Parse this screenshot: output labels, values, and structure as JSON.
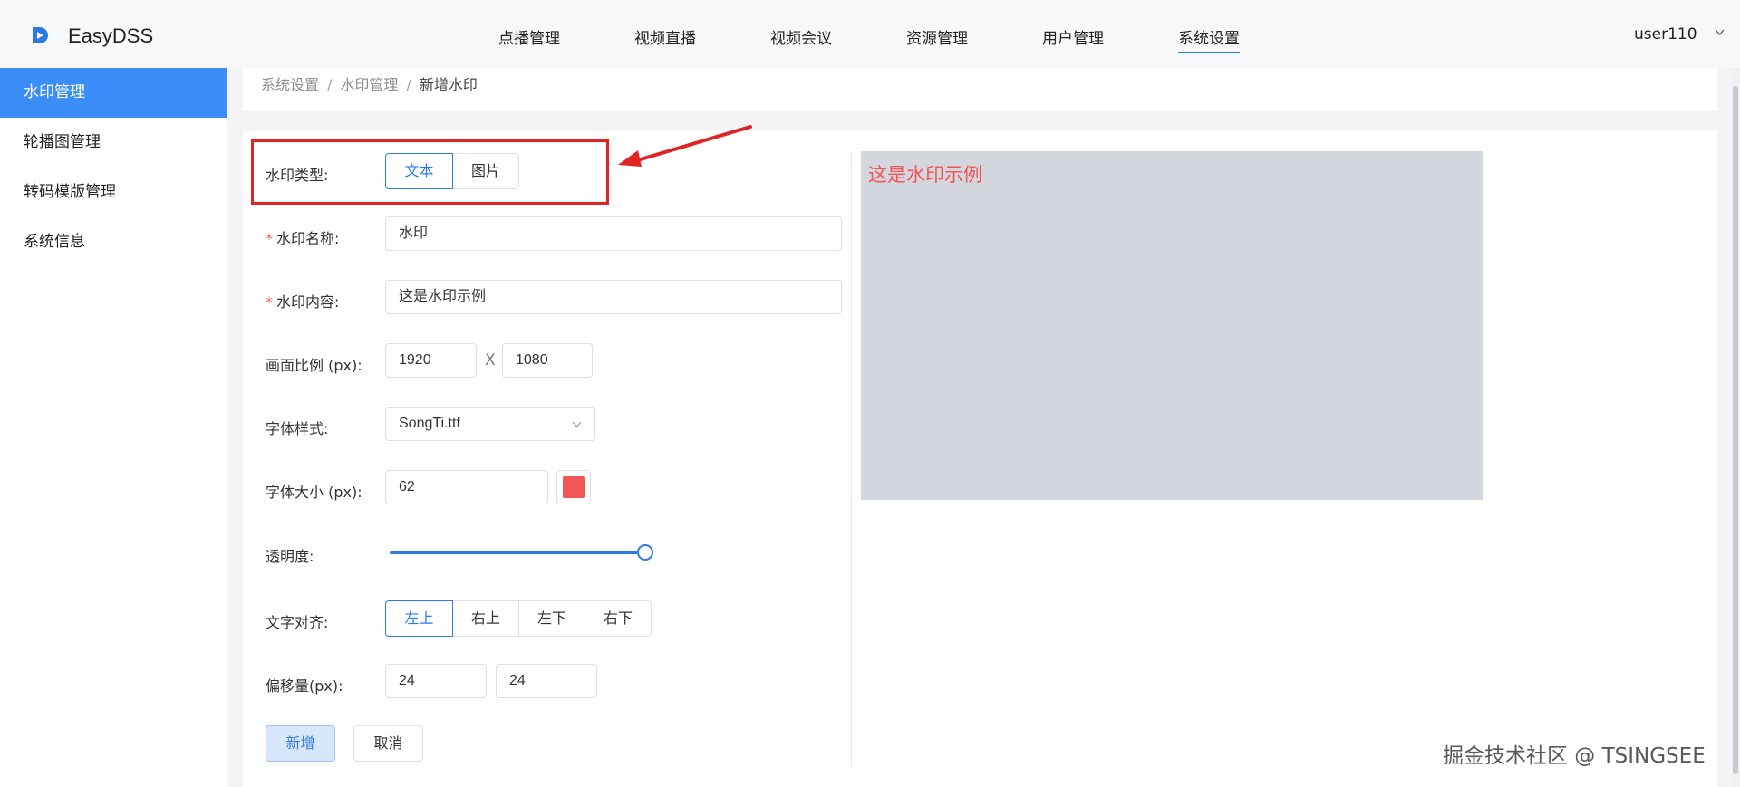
{
  "header": {
    "brand": "EasyDSS",
    "nav": [
      {
        "label": "点播管理"
      },
      {
        "label": "视频直播"
      },
      {
        "label": "视频会议"
      },
      {
        "label": "资源管理"
      },
      {
        "label": "用户管理"
      },
      {
        "label": "系统设置",
        "active": true
      }
    ],
    "user": "user110"
  },
  "sidebar": {
    "items": [
      {
        "label": "水印管理",
        "active": true
      },
      {
        "label": "轮播图管理"
      },
      {
        "label": "转码模版管理"
      },
      {
        "label": "系统信息"
      }
    ]
  },
  "breadcrumb": {
    "items": [
      "系统设置",
      "水印管理",
      "新增水印"
    ],
    "separator": "/"
  },
  "form": {
    "type": {
      "label": "水印类型:",
      "options": [
        "文本",
        "图片"
      ],
      "selected": "文本"
    },
    "name": {
      "required_mark": "*",
      "label": "水印名称:",
      "value": "水印"
    },
    "content": {
      "required_mark": "*",
      "label": "水印内容:",
      "value": "这是水印示例"
    },
    "ratio": {
      "label": "画面比例 (px):",
      "width": "1920",
      "times": "X",
      "height": "1080"
    },
    "font_style": {
      "label": "字体样式:",
      "value": "SongTi.ttf"
    },
    "font_size": {
      "label": "字体大小 (px):",
      "value": "62",
      "color": "#f25656"
    },
    "opacity": {
      "label": "透明度:",
      "value": 1.0
    },
    "align": {
      "label": "文字对齐:",
      "options": [
        "左上",
        "右上",
        "左下",
        "右下"
      ],
      "selected": "左上"
    },
    "offset": {
      "label": "偏移量(px):",
      "x": "24",
      "y": "24"
    },
    "buttons": {
      "add": "新增",
      "cancel": "取消"
    }
  },
  "preview": {
    "text": "这是水印示例",
    "text_color": "#f25656",
    "background": "#d4d6dd"
  },
  "annotation": {
    "color": "#e02424"
  },
  "watermark": "掘金技术社区 @ TSINGSEE",
  "colors": {
    "accent": "#2c7be5",
    "sidebar_active": "#3b8ef7"
  }
}
